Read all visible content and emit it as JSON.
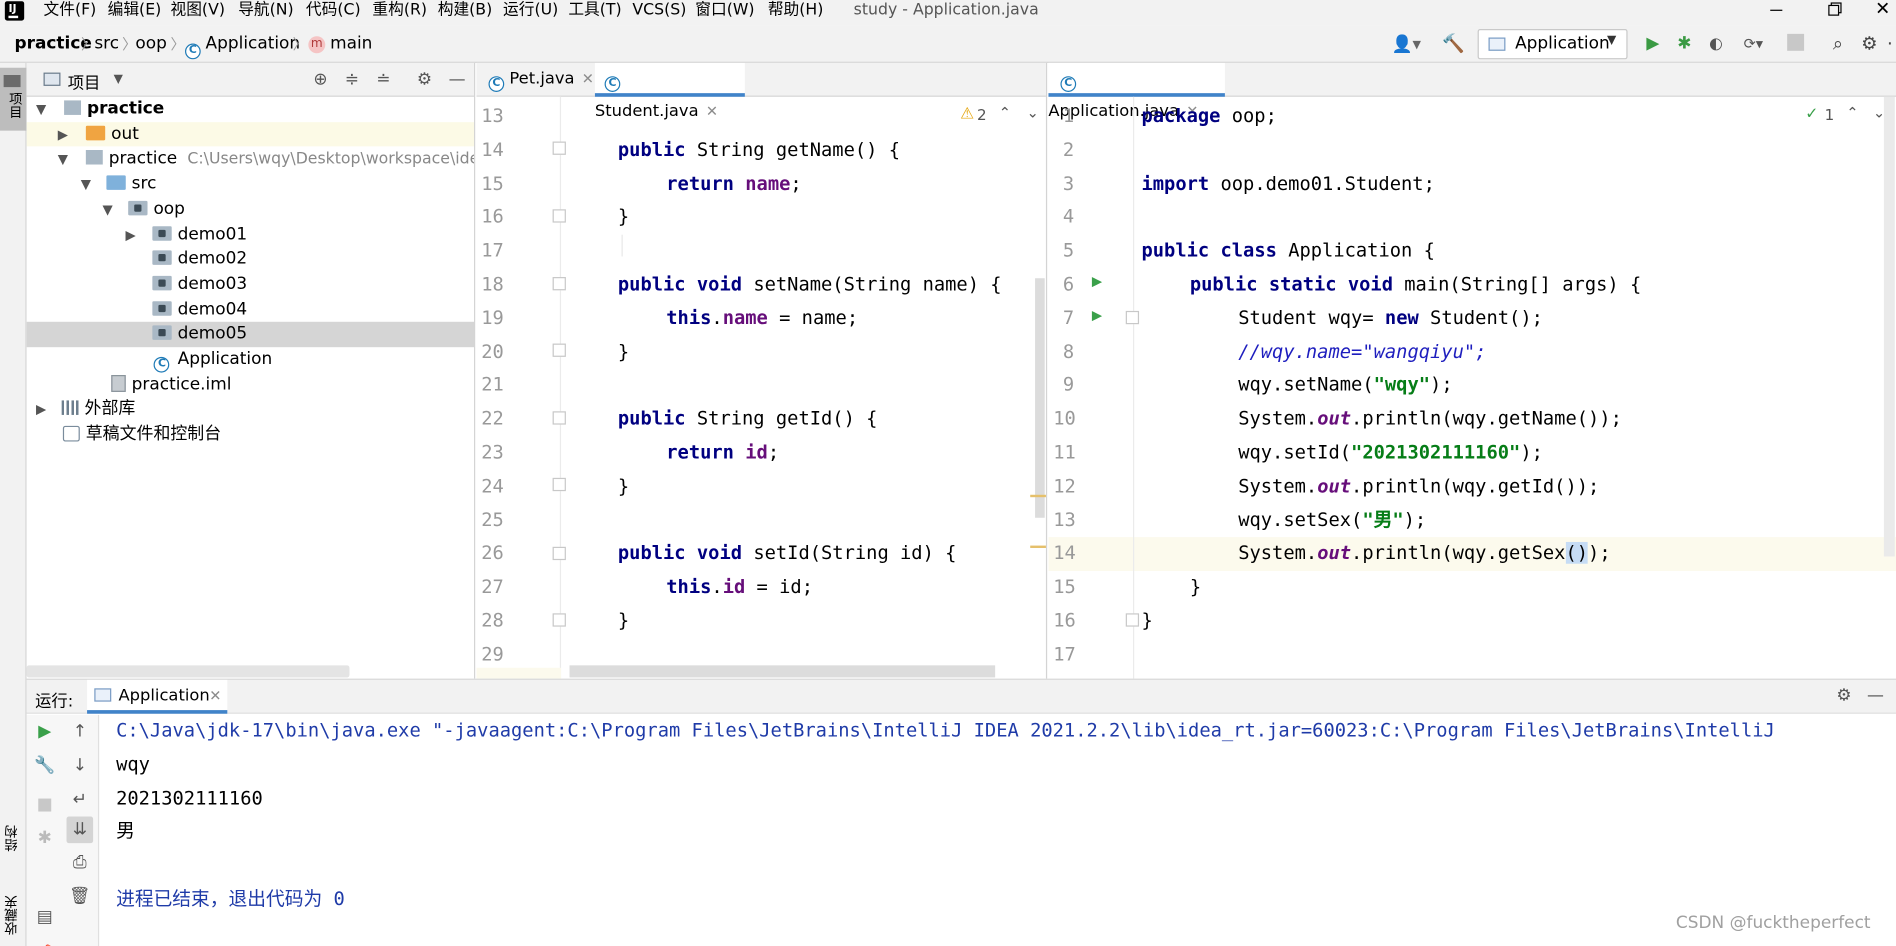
{
  "menu": {
    "items": [
      "文件(F)",
      "编辑(E)",
      "视图(V)",
      "导航(N)",
      "代码(C)",
      "重构(R)",
      "构建(B)",
      "运行(U)",
      "工具(T)",
      "VCS(S)",
      "窗口(W)",
      "帮助(H)"
    ],
    "title": "study - Application.java"
  },
  "nav": {
    "crumbs": [
      "practice",
      "src",
      "oop",
      "Application",
      "main"
    ],
    "run_config": "Application"
  },
  "project_panel": {
    "title": "项目",
    "side_tab": "项目",
    "tree": [
      {
        "label": "practice",
        "bold": true
      },
      {
        "label": "out"
      },
      {
        "label": "practice",
        "path": "C:\\Users\\wqy\\Desktop\\workspace\\ideawo"
      },
      {
        "label": "src"
      },
      {
        "label": "oop"
      },
      {
        "label": "demo01"
      },
      {
        "label": "demo02"
      },
      {
        "label": "demo03"
      },
      {
        "label": "demo04"
      },
      {
        "label": "demo05"
      },
      {
        "label": "Application"
      },
      {
        "label": "practice.iml"
      },
      {
        "label": "外部库"
      },
      {
        "label": "草稿文件和控制台"
      }
    ]
  },
  "left_editor": {
    "tabs": [
      "Pet.java",
      "Student.java"
    ],
    "warnings": "2",
    "line_numbers": [
      "13",
      "14",
      "15",
      "16",
      "17",
      "18",
      "19",
      "20",
      "21",
      "22",
      "23",
      "24",
      "25",
      "26",
      "27",
      "28",
      "29"
    ],
    "tokens": {
      "public": "public",
      "return": "return",
      "this": "this",
      "void": "void",
      "getName": " String getName() {",
      "name": "name",
      ";": ";",
      "}": "}",
      "setName": " setName(String name) {",
      "dot": ".",
      "eqName": " = name;",
      "getId": " String getId() {",
      "id": "id",
      "setId": " setId(String id) {",
      "eqId": " = id;"
    }
  },
  "right_editor": {
    "tabs": [
      "Application.java"
    ],
    "checks": "1",
    "line_numbers": [
      "1",
      "2",
      "3",
      "4",
      "5",
      "6",
      "7",
      "8",
      "9",
      "10",
      "11",
      "12",
      "13",
      "14",
      "15",
      "16",
      "17"
    ],
    "tokens": {
      "package": "package",
      "pkg": " oop;",
      "import": "import",
      "imp": " oop.demo01.Student;",
      "public": "public",
      "class": "class",
      "classTail": " Application {",
      "static": "static",
      "void": "void",
      "mainSig": " main(String[] args) {",
      "new": "new",
      "l7a": "Student wqy= ",
      "l7b": " Student();",
      "comment": "//wqy.name=\"wangqiyu\";",
      "l9a": "wqy.setName(",
      "s_wqy": "\"wqy\"",
      "l9b": ");",
      "sys": "System.",
      "out": "out",
      "l10b": ".println(wqy.getName());",
      "l11a": "wqy.setId(",
      "s_id": "\"2021302111160\"",
      "l11b": ");",
      "l12b": ".println(wqy.getId());",
      "l13a": "wqy.setSex(",
      "s_sex": "\"男\"",
      "l13b": ");",
      "l14b": ".println(wqy.getSex",
      "l14p": "()",
      "l14c": ");",
      "cb": "}"
    }
  },
  "run_panel": {
    "label": "运行:",
    "tab": "Application",
    "side_tabs": [
      "结构",
      "收藏夹"
    ],
    "output": [
      "C:\\Java\\jdk-17\\bin\\java.exe \"-javaagent:C:\\Program Files\\JetBrains\\IntelliJ IDEA 2021.2.2\\lib\\idea_rt.jar=60023:C:\\Program Files\\JetBrains\\IntelliJ",
      "wqy",
      "2021302111160",
      "男",
      "",
      "进程已结束，退出代码为 0"
    ]
  },
  "watermark": "CSDN @fucktheperfect",
  "colors": {
    "keyword": "#000080",
    "field": "#660e7a",
    "string": "#067d17",
    "comment": "#1e1ebe",
    "link": "#1f3ba8",
    "caret_line": "#fcfaed"
  }
}
